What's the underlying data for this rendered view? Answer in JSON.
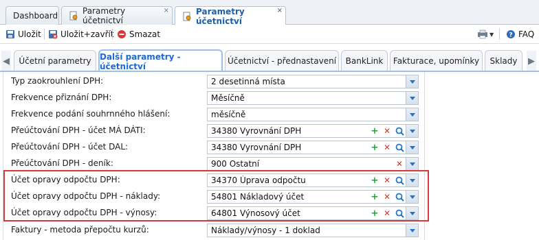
{
  "doc_tabs": [
    {
      "label": "Dashboard",
      "closable": false,
      "active": false
    },
    {
      "label": "Parametry účetnictví",
      "closable": true,
      "active": false
    },
    {
      "label": "Parametry účetnictví",
      "closable": true,
      "active": true
    }
  ],
  "toolbar": {
    "save_label": "Uložit",
    "save_close_label": "Uložit+zavřít",
    "delete_label": "Smazat",
    "faq_label": "FAQ"
  },
  "param_tabs": [
    {
      "label": "Účetní parametry",
      "active": false
    },
    {
      "label": "Další parametry - účetnictví",
      "active": true
    },
    {
      "label": "Účetnictví - přednastavení",
      "active": false
    },
    {
      "label": "BankLink",
      "active": false
    },
    {
      "label": "Fakturace, upomínky",
      "active": false
    },
    {
      "label": "Sklady",
      "active": false
    }
  ],
  "fields": [
    {
      "label": "Typ zaokrouhlení DPH:",
      "value": "2 desetinná místa",
      "buttons": [
        "drop"
      ]
    },
    {
      "label": "Frekvence přiznání DPH:",
      "value": "Měsíčně",
      "buttons": [
        "drop"
      ]
    },
    {
      "label": "Frekvence podání souhrnného hlášení:",
      "value": "měsíčně",
      "buttons": [
        "drop"
      ]
    },
    {
      "label": "Přeúčtování DPH - účet MÁ DÁTI:",
      "value": "34380 Vyrovnání DPH",
      "buttons": [
        "add",
        "del",
        "search",
        "drop"
      ]
    },
    {
      "label": "Přeúčtování DPH - účet DAL:",
      "value": "34380 Vyrovnání DPH",
      "buttons": [
        "add",
        "del",
        "search",
        "drop"
      ]
    },
    {
      "label": "Přeúčtování DPH - deník:",
      "value": "900 Ostatní",
      "buttons": [
        "del",
        "drop"
      ]
    },
    {
      "label": "Účet opravy odpočtu DPH:",
      "value": "34370 Úprava odpočtu",
      "buttons": [
        "add",
        "del",
        "search",
        "drop"
      ]
    },
    {
      "label": "Účet opravy odpočtu DPH - náklady:",
      "value": "54801 Nákladový účet",
      "buttons": [
        "add",
        "del",
        "search",
        "drop"
      ]
    },
    {
      "label": "Účet opravy odpočtu DPH - výnosy:",
      "value": "64801 Výnosový účet",
      "buttons": [
        "add",
        "del",
        "search",
        "drop"
      ]
    },
    {
      "label": "Faktury - metoda přepočtu kurzů:",
      "value": "Náklady/výnosy - 1 doklad",
      "buttons": [
        "drop"
      ]
    }
  ],
  "colors": {
    "accent": "#1d6ad0",
    "highlight": "#d9383a",
    "add": "#2e9a3b",
    "delete": "#d8392a"
  }
}
